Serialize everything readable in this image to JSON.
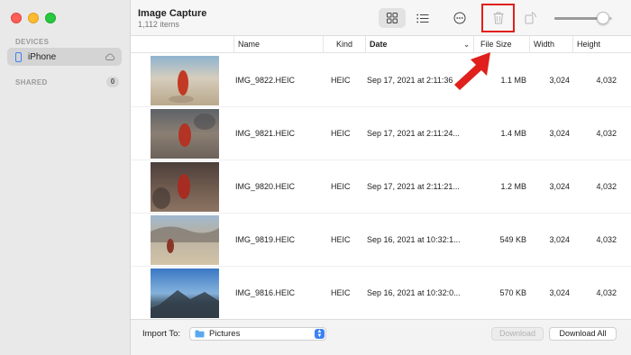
{
  "window": {
    "title": "Image Capture",
    "subtitle": "1,112 items"
  },
  "sidebar": {
    "devices_label": "DEVICES",
    "device_name": "iPhone",
    "shared_label": "SHARED",
    "shared_count": "0"
  },
  "toolbar": {
    "icons": [
      "grid-view-icon",
      "list-view-icon",
      "more-options-icon",
      "trash-icon",
      "rotate-icon",
      "zoom-slider"
    ],
    "zoom_level": 0.85
  },
  "table": {
    "columns": [
      "Name",
      "Kind",
      "Date",
      "File Size",
      "Width",
      "Height"
    ],
    "sort_column": "Date",
    "rows": [
      {
        "name": "IMG_9822.HEIC",
        "kind": "HEIC",
        "date": "Sep 17, 2021 at 2:11:36",
        "size": "1.1 MB",
        "width": "3,024",
        "height": "4,032"
      },
      {
        "name": "IMG_9821.HEIC",
        "kind": "HEIC",
        "date": "Sep 17, 2021 at 2:11:24...",
        "size": "1.4 MB",
        "width": "3,024",
        "height": "4,032"
      },
      {
        "name": "IMG_9820.HEIC",
        "kind": "HEIC",
        "date": "Sep 17, 2021 at 2:11:21...",
        "size": "1.2 MB",
        "width": "3,024",
        "height": "4,032"
      },
      {
        "name": "IMG_9819.HEIC",
        "kind": "HEIC",
        "date": "Sep 16, 2021 at 10:32:1...",
        "size": "549 KB",
        "width": "3,024",
        "height": "4,032"
      },
      {
        "name": "IMG_9816.HEIC",
        "kind": "HEIC",
        "date": "Sep 16, 2021 at 10:32:0...",
        "size": "570 KB",
        "width": "3,024",
        "height": "4,032"
      }
    ]
  },
  "footer": {
    "import_label": "Import To:",
    "import_value": "Pictures",
    "download_label": "Download",
    "download_all_label": "Download All"
  },
  "colors": {
    "accent": "#3b82f6",
    "annotation_red": "#e0201c"
  }
}
